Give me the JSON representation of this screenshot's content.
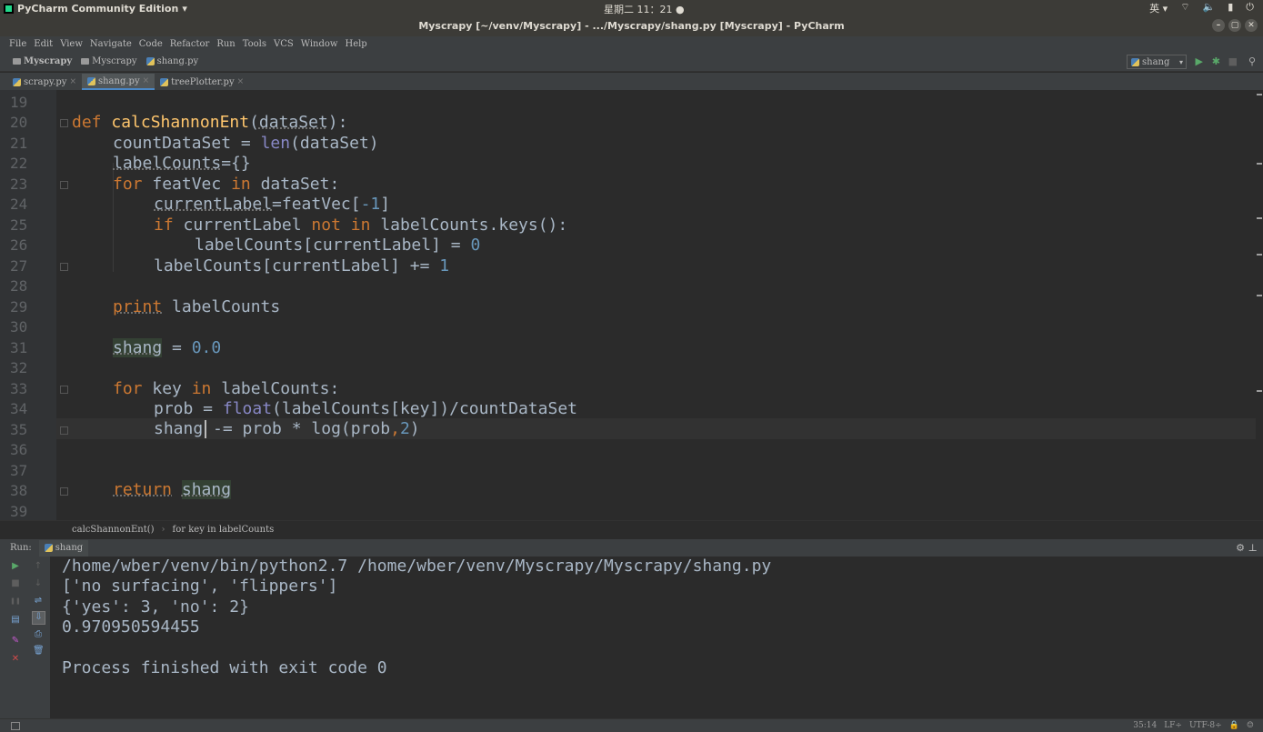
{
  "top_panel": {
    "app_name": "PyCharm Community Edition",
    "dropdown": "▾",
    "clock": "星期二 11：21 ●",
    "ime": "英 ▾",
    "wifi": "⌔",
    "volume": "🔈",
    "battery": "▮",
    "power": "⏻"
  },
  "window": {
    "title": "Myscrapy [~/venv/Myscrapy] - .../Myscrapy/shang.py [Myscrapy] - PyCharm",
    "min": "–",
    "max": "▢",
    "close": "✕"
  },
  "menu": [
    "File",
    "Edit",
    "View",
    "Navigate",
    "Code",
    "Refactor",
    "Run",
    "Tools",
    "VCS",
    "Window",
    "Help"
  ],
  "nav": {
    "crumbs": [
      "Myscrapy",
      "Myscrapy",
      "shang.py"
    ],
    "run_config": "shang",
    "run_glyph": "▶",
    "debug_glyph": "✱",
    "stop_glyph": "■",
    "search_glyph": "⚲",
    "caret_glyph": "▾"
  },
  "tabs": [
    {
      "label": "scrapy.py",
      "active": false
    },
    {
      "label": "shang.py",
      "active": true
    },
    {
      "label": "treePlotter.py",
      "active": false
    }
  ],
  "tab_close": "×",
  "editor": {
    "line_numbers": [
      "19",
      "20",
      "21",
      "22",
      "23",
      "24",
      "25",
      "26",
      "27",
      "28",
      "29",
      "30",
      "31",
      "32",
      "33",
      "34",
      "35",
      "36",
      "37",
      "38",
      "39"
    ],
    "kw": {
      "def": "def",
      "for": "for",
      "in": "in",
      "if": "if",
      "not": "not",
      "print": "print",
      "return": "return"
    },
    "names": {
      "fn_name": "calcShannonEnt",
      "dataSet": "dataSet",
      "countDataSet": "countDataSet",
      "len": "len",
      "labelCounts": "labelCounts",
      "featVec": "featVec",
      "currentLabel": "currentLabel",
      "shang": "shang",
      "key": "key",
      "prob": "prob",
      "float": "float",
      "log": "log"
    },
    "nums": {
      "neg1": "-1",
      "zero": "0",
      "one": "1",
      "zero_f": "0.0",
      "two": "2"
    },
    "punct": {
      "l20_open": "(",
      "l20_close": "):",
      "l21_eq": " = ",
      "l21_open": "(",
      "l21_close": ")",
      "l22_rest": "={}",
      "l23_colon": ":",
      "l24_mid": "=featVec[",
      "l24_close": "]",
      "l25_keys": "labelCounts.keys():",
      "l26_text": "labelCounts[currentLabel] = ",
      "l27_text": "labelCounts[currentLabel] += ",
      "l29_rest": " labelCounts",
      "l31_eq": " = ",
      "l33_rest": " labelCounts:",
      "l34_eq": "prob = ",
      "l34_rest": "(labelCounts[key])/countDataSet",
      "l35_mid": " -= prob * log(prob",
      "l35_comma": ",",
      "l35_close": ")"
    }
  },
  "editor_breadcrumb": [
    "calcShannonEnt()",
    "for key in labelCounts"
  ],
  "breadcrumb_sep": "›",
  "run_panel": {
    "label": "Run:",
    "tab": "shang",
    "gear": "⚙",
    "pin": "⊥",
    "buttons": {
      "rerun": "▶",
      "stop": "■",
      "pause": "❚❚",
      "dump": "▤",
      "pin": "✎",
      "close": "✕",
      "up": "↑",
      "down": "↓",
      "wrap": "⇌",
      "scroll": "⇩",
      "print": "⎙",
      "trash": "🗑"
    },
    "output": [
      "/home/wber/venv/bin/python2.7 /home/wber/venv/Myscrapy/Myscrapy/shang.py",
      "['no surfacing', 'flippers']",
      "{'yes': 3, 'no': 2}",
      "0.970950594455",
      "",
      "Process finished with exit code 0"
    ]
  },
  "status": {
    "position": "35:14",
    "line_sep": "LF÷",
    "encoding": "UTF-8÷",
    "lock": "🔒",
    "inspect": "☺"
  }
}
